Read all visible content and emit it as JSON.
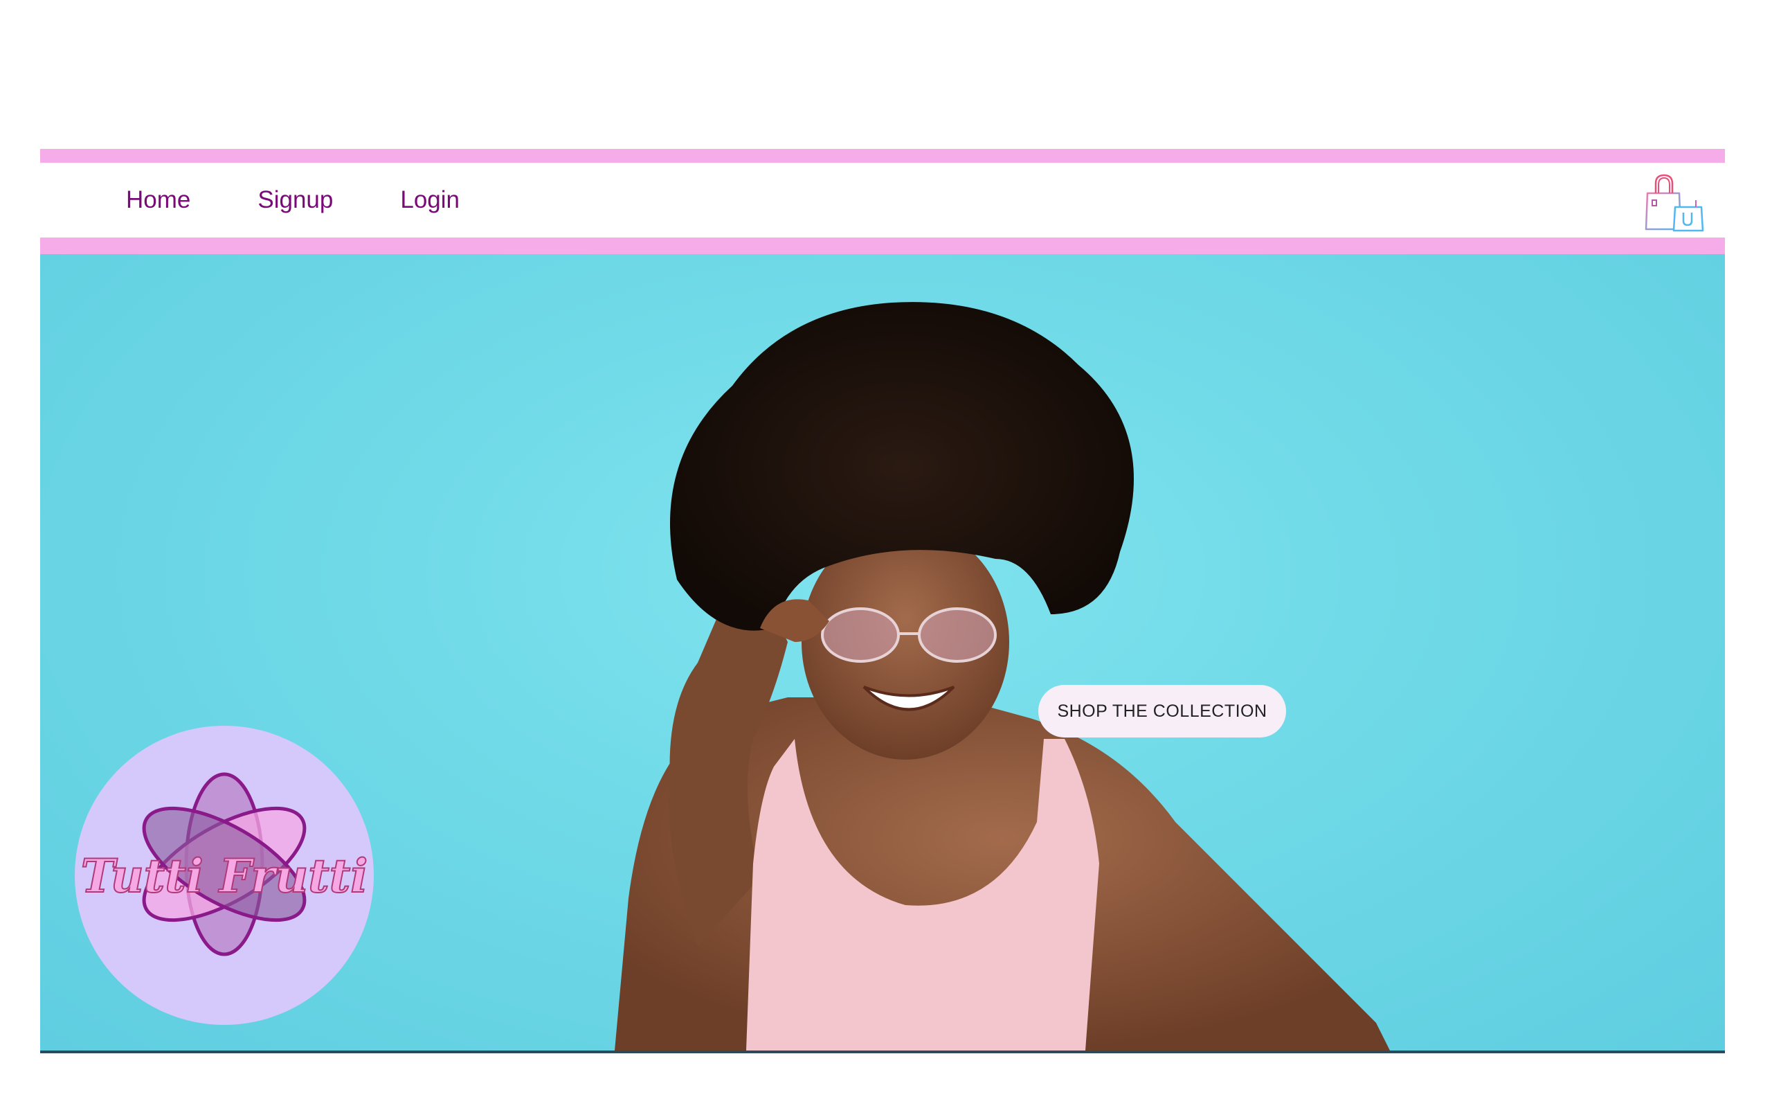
{
  "nav": {
    "links": [
      "Home",
      "Signup",
      "Login"
    ],
    "cart_icon": "shopping-bags-icon"
  },
  "hero": {
    "cta_label": "SHOP THE COLLECTION",
    "image": "woman-with-glasses-photo"
  },
  "logo": {
    "text": "Tutti Frutti",
    "icon": "flower-petals-logo"
  },
  "colors": {
    "accent_bar": "#f6ace9",
    "nav_text": "#7a0a78",
    "hero_bg": "#6fd9e7",
    "logo_circle": "#d5c8fb",
    "cta_bg": "#f7eef7"
  }
}
